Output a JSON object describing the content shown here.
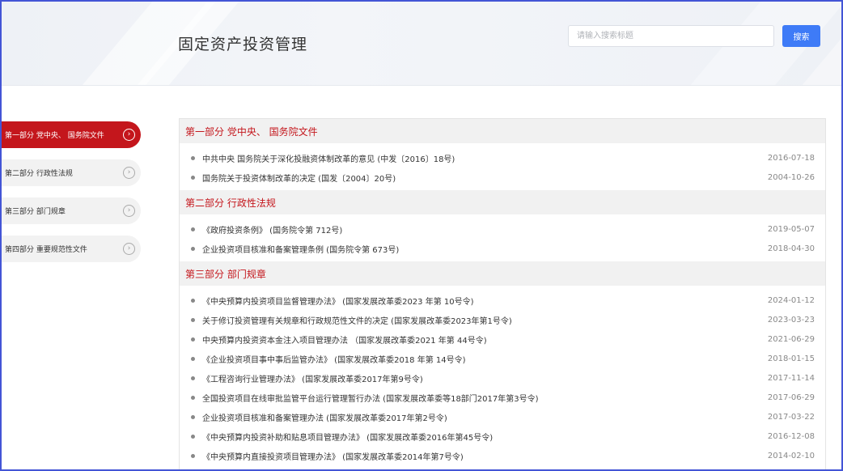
{
  "header": {
    "title": "固定资产投资管理",
    "search_placeholder": "请输入搜索标题",
    "search_button": "搜索"
  },
  "sidebar": {
    "items": [
      {
        "label": "第一部分 党中央、 国务院文件",
        "active": true
      },
      {
        "label": "第二部分 行政性法规",
        "active": false
      },
      {
        "label": "第三部分 部门规章",
        "active": false
      },
      {
        "label": "第四部分 重要规范性文件",
        "active": false
      }
    ],
    "chevron_icon": "chevron-right-circle"
  },
  "sections": [
    {
      "title": "第一部分 党中央、 国务院文件",
      "rows": [
        {
          "text": "中共中央 国务院关于深化投融资体制改革的意见 (中发〔2016〕18号)",
          "date": "2016-07-18"
        },
        {
          "text": "国务院关于投资体制改革的决定 (国发〔2004〕20号)",
          "date": "2004-10-26"
        }
      ]
    },
    {
      "title": "第二部分 行政性法规",
      "rows": [
        {
          "text": "《政府投资条例》 (国务院令第 712号)",
          "date": "2019-05-07"
        },
        {
          "text": "企业投资项目核准和备案管理条例 (国务院令第 673号)",
          "date": "2018-04-30"
        }
      ]
    },
    {
      "title": "第三部分 部门规章",
      "rows": [
        {
          "text": "《中央预算内投资项目监督管理办法》 (国家发展改革委2023 年第 10号令)",
          "date": "2024-01-12"
        },
        {
          "text": "关于修订投资管理有关规章和行政规范性文件的决定 (国家发展改革委2023年第1号令)",
          "date": "2023-03-23"
        },
        {
          "text": "中央预算内投资资本金注入项目管理办法 （国家发展改革委2021 年第 44号令)",
          "date": "2021-06-29"
        },
        {
          "text": "《企业投资项目事中事后监管办法》 (国家发展改革委2018 年第 14号令)",
          "date": "2018-01-15"
        },
        {
          "text": "《工程咨询行业管理办法》 (国家发展改革委2017年第9号令)",
          "date": "2017-11-14"
        },
        {
          "text": "全国投资项目在线审批监管平台运行管理暂行办法 (国家发展改革委等18部门2017年第3号令)",
          "date": "2017-06-29"
        },
        {
          "text": "企业投资项目核准和备案管理办法 (国家发展改革委2017年第2号令)",
          "date": "2017-03-22"
        },
        {
          "text": "《中央预算内投资补助和贴息项目管理办法》 (国家发展改革委2016年第45号令)",
          "date": "2016-12-08"
        },
        {
          "text": "《中央预算内直接投资项目管理办法》 (国家发展改革委2014年第7号令)",
          "date": "2014-02-10"
        }
      ]
    }
  ],
  "colors": {
    "accent_red": "#c4161c",
    "button_blue": "#3e7bf7",
    "frame_blue": "#4355d6"
  }
}
